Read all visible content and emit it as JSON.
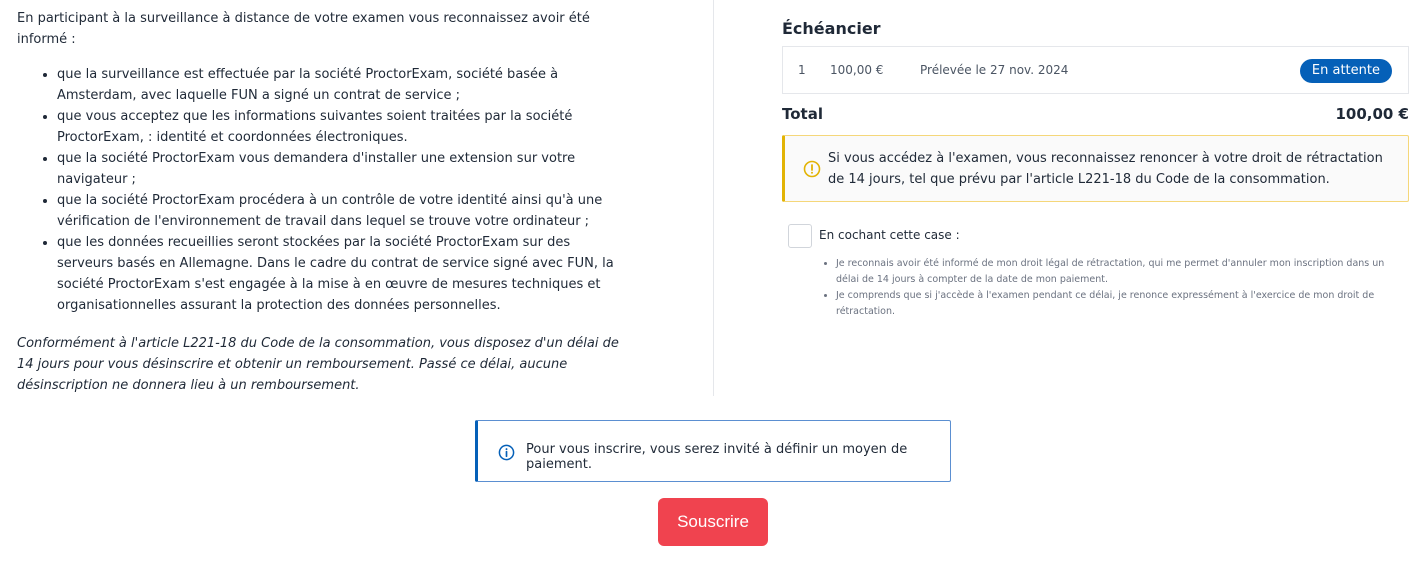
{
  "left": {
    "intro": "En participant à la surveillance à distance de votre examen vous reconnaissez avoir été informé :",
    "items": [
      "que la surveillance est effectuée par la société ProctorExam, société basée à Amsterdam, avec laquelle FUN a signé un contrat de service ;",
      "que vous acceptez que les informations suivantes soient traitées par la société ProctorExam, : identité et coordonnées électroniques.",
      "que la société ProctorExam vous demandera d'installer une extension sur votre navigateur ;",
      "que la société ProctorExam procédera à un contrôle de votre identité ainsi qu'à une vérification de l'environnement de travail dans lequel se trouve votre ordinateur ;",
      "que les données recueillies seront stockées par la société ProctorExam sur des serveurs basés en Allemagne. Dans le cadre du contrat de service signé avec FUN, la société ProctorExam s'est engagée à la mise à en œuvre de mesures techniques et organisationnelles assurant la protection des données personnelles."
    ],
    "legal": "Conformément à l'article L221-18 du Code de la consommation, vous disposez d'un délai de 14 jours pour vous désinscrire et obtenir un remboursement. Passé ce délai, aucune désinscription ne donnera lieu à un remboursement."
  },
  "schedule": {
    "title": "Échéancier",
    "row": {
      "index": "1",
      "amount": "100,00 €",
      "date": "Prélevée le 27 nov. 2024",
      "status": "En attente"
    }
  },
  "total": {
    "label": "Total",
    "value": "100,00 €"
  },
  "warning": {
    "icon": "warning-circle-icon",
    "text": "Si vous accédez à l'examen, vous reconnaissez renoncer à votre droit de rétractation de 14 jours, tel que prévu par l'article L221-18 du Code de la consommation."
  },
  "consent": {
    "label": "En cochant cette case :",
    "items": [
      "Je reconnais avoir été informé de mon droit légal de rétractation, qui me permet d'annuler mon inscription dans un délai de 14 jours à compter de la date de mon paiement.",
      "Je comprends que si j'accède à l'examen pendant ce délai, je renonce expressément à l'exercice de mon droit de rétractation."
    ]
  },
  "info": {
    "icon": "info-circle-icon",
    "text": "Pour vous inscrire, vous serez invité à définir un moyen de paiement."
  },
  "subscribe_label": "Souscrire",
  "colors": {
    "primary": "#0560b8",
    "danger": "#f0434f",
    "warning": "#e2b304"
  }
}
